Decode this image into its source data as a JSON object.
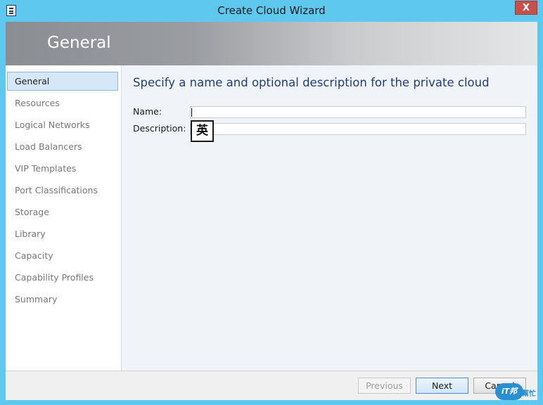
{
  "window": {
    "title": "Create Cloud Wizard",
    "close_glyph": "X"
  },
  "header": {
    "title": "General"
  },
  "nav": {
    "items": [
      {
        "label": "General",
        "active": true
      },
      {
        "label": "Resources"
      },
      {
        "label": "Logical Networks"
      },
      {
        "label": "Load Balancers"
      },
      {
        "label": "VIP Templates"
      },
      {
        "label": "Port Classifications"
      },
      {
        "label": "Storage"
      },
      {
        "label": "Library"
      },
      {
        "label": "Capacity"
      },
      {
        "label": "Capability Profiles"
      },
      {
        "label": "Summary"
      }
    ]
  },
  "main": {
    "heading": "Specify a name and optional description for the private cloud",
    "name_label": "Name:",
    "name_value": "",
    "description_label": "Description:",
    "description_value": "",
    "ime_indicator": "英"
  },
  "footer": {
    "previous_label": "Previous",
    "next_label": "Next",
    "cancel_label": "Cancel"
  },
  "watermark": {
    "badge": "iT邦",
    "text": "幫忙"
  },
  "colors": {
    "heading": "#1f3e7b",
    "header_gradient_start": "#8a8d91",
    "selected_nav": "#d6e7f8",
    "title_bar": "#5ec8ee"
  }
}
